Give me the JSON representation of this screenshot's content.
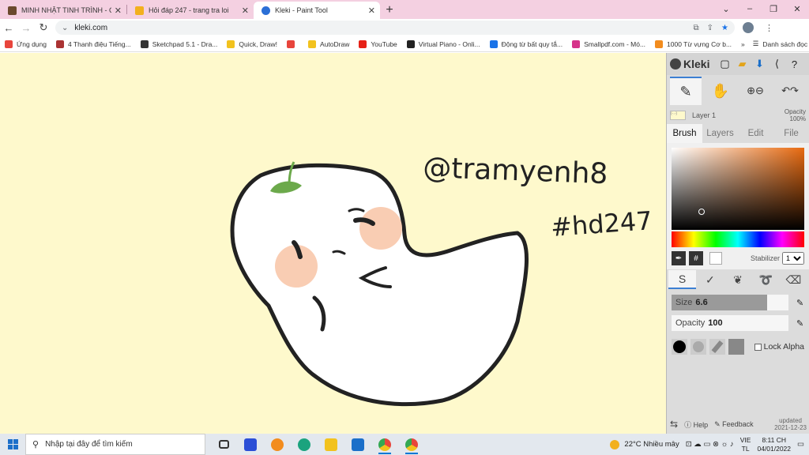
{
  "browser": {
    "tabs": [
      {
        "title": "MINH NHẬT TINH TRÌNH - CHAR",
        "active": false,
        "color": "#6b4a2e"
      },
      {
        "title": "Hỏi đáp 247 - trang tra loi",
        "active": false,
        "color": "#f2b01e"
      },
      {
        "title": "Kleki - Paint Tool",
        "active": true,
        "color": "#2b6fd6"
      }
    ],
    "new_tab": "+",
    "url": "kleki.com",
    "window_controls": [
      "⌄",
      "–",
      "❐",
      "✕"
    ]
  },
  "bookmarks": [
    {
      "label": "Ứng dụng",
      "color": "#e8453c"
    },
    {
      "label": "4 Thanh điệu Tiếng...",
      "color": "#a33"
    },
    {
      "label": "Sketchpad 5.1 - Dra...",
      "color": "#333"
    },
    {
      "label": "Quick, Draw!",
      "color": "#f2c21e"
    },
    {
      "label": "",
      "color": "#e8453c"
    },
    {
      "label": "AutoDraw",
      "color": "#f2c21e"
    },
    {
      "label": "YouTube",
      "color": "#e62117"
    },
    {
      "label": "Virtual Piano - Onli...",
      "color": "#222"
    },
    {
      "label": "Động từ bất quy tắ...",
      "color": "#1a73e8"
    },
    {
      "label": "Smallpdf.com - Mó...",
      "color": "#d6338a"
    },
    {
      "label": "1000 Từ vựng Cơ b...",
      "color": "#f28c1e"
    }
  ],
  "bookmarks_more": "»",
  "reading_list": "Danh sách đọc",
  "canvas": {
    "bg": "#fef9cc",
    "text_handle": "@tramyenh8",
    "text_tag": "#hd247"
  },
  "kleki": {
    "brand": "Kleki",
    "layer": {
      "name": "Layer 1",
      "opacity_label": "Opacity",
      "opacity_value": "100%",
      "thumb_text": "(-.-)"
    },
    "tabs": [
      "Brush",
      "Layers",
      "Edit",
      "File"
    ],
    "color_hex_label": "#",
    "stabilizer_label": "Stabilizer",
    "stabilizer_value": "1",
    "size_label": "Size",
    "size_value": "6.6",
    "size_fraction": 0.82,
    "opacity_label": "Opacity",
    "opacity_value": "100",
    "opacity_fraction": 0,
    "lock_alpha": "Lock Alpha",
    "help": "Help",
    "feedback": "Feedback",
    "updated_label": "updated",
    "updated_date": "2021-12-23"
  },
  "taskbar": {
    "search_placeholder": "Nhập tại đây để tìm kiếm",
    "weather": "22°C  Nhiều mây",
    "lang_top": "VIE",
    "lang_bottom": "TL",
    "time": "8:11 CH",
    "date": "04/01/2022"
  }
}
